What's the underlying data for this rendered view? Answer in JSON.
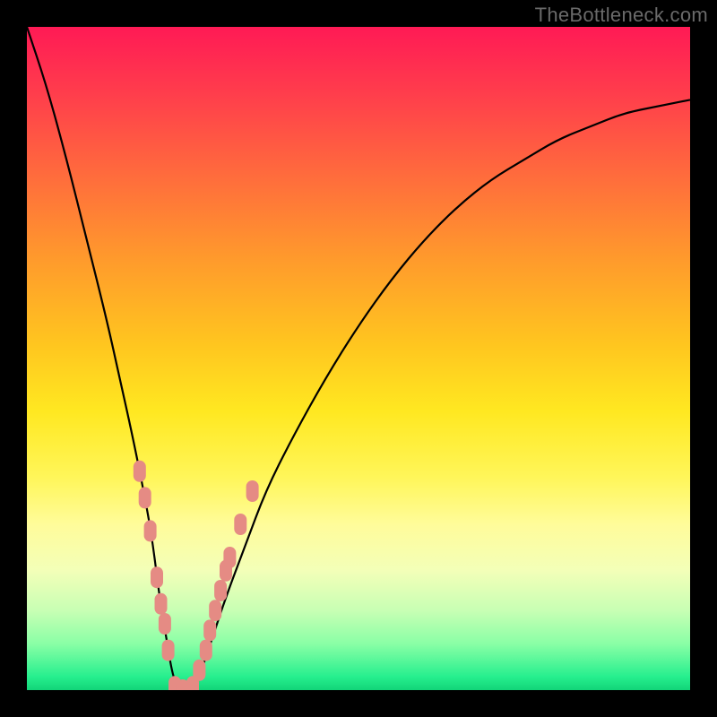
{
  "watermark": "TheBottleneck.com",
  "chart_data": {
    "type": "line",
    "title": "",
    "xlabel": "",
    "ylabel": "",
    "xlim": [
      0,
      100
    ],
    "ylim": [
      0,
      100
    ],
    "grid": false,
    "legend": false,
    "background_gradient": {
      "stops": [
        {
          "pct": 0,
          "color": "#ff1a55"
        },
        {
          "pct": 50,
          "color": "#ffe821"
        },
        {
          "pct": 100,
          "color": "#12d478"
        }
      ]
    },
    "series": [
      {
        "name": "bottleneck-curve",
        "x": [
          0,
          3,
          6,
          9,
          12,
          14,
          16,
          18,
          19,
          20,
          21,
          22,
          23,
          24,
          26,
          28,
          30,
          33,
          36,
          40,
          45,
          50,
          55,
          60,
          65,
          70,
          75,
          80,
          85,
          90,
          95,
          100
        ],
        "values": [
          100,
          91,
          80,
          68,
          56,
          47,
          38,
          28,
          22,
          14,
          8,
          2,
          0,
          0,
          2,
          8,
          14,
          22,
          30,
          38,
          47,
          55,
          62,
          68,
          73,
          77,
          80,
          83,
          85,
          87,
          88,
          89
        ]
      }
    ],
    "markers": [
      {
        "x": 17.0,
        "y": 33
      },
      {
        "x": 17.8,
        "y": 29
      },
      {
        "x": 18.6,
        "y": 24
      },
      {
        "x": 19.6,
        "y": 17
      },
      {
        "x": 20.2,
        "y": 13
      },
      {
        "x": 20.8,
        "y": 10
      },
      {
        "x": 21.3,
        "y": 6
      },
      {
        "x": 22.3,
        "y": 0.5
      },
      {
        "x": 23.5,
        "y": 0
      },
      {
        "x": 25.0,
        "y": 0.5
      },
      {
        "x": 26.0,
        "y": 3
      },
      {
        "x": 27.0,
        "y": 6
      },
      {
        "x": 27.6,
        "y": 9
      },
      {
        "x": 28.4,
        "y": 12
      },
      {
        "x": 29.2,
        "y": 15
      },
      {
        "x": 30.0,
        "y": 18
      },
      {
        "x": 30.6,
        "y": 20
      },
      {
        "x": 32.2,
        "y": 25
      },
      {
        "x": 34.0,
        "y": 30
      }
    ],
    "marker_shape": "rounded-rect",
    "marker_color": "#e58b84",
    "notes": "Values are read visually from the chart. x and values are percentages of the plot width/height (0 to 100). The curve falls steeply from top-left, reaches 0 near x 23, then rises with decreasing slope toward the right edge near y 89. Pink markers cluster on both flanks near the valley."
  }
}
